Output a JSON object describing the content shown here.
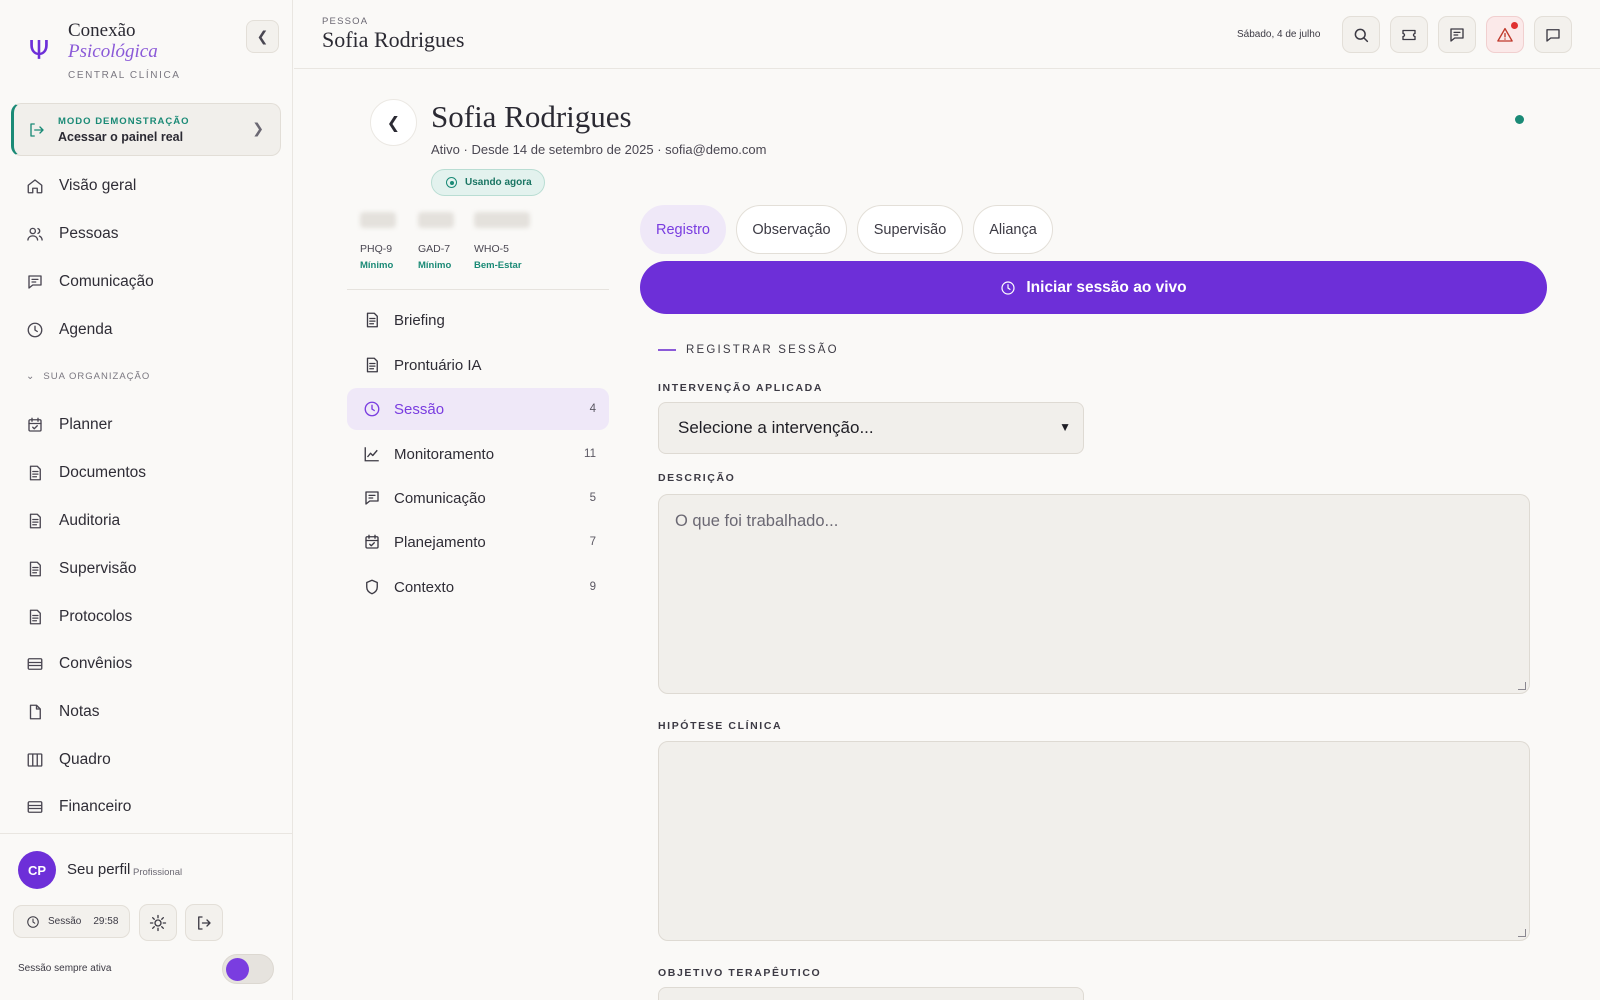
{
  "brand": {
    "line1": "Conexão",
    "line2": "Psicológica",
    "line3": "CENTRAL CLÍNICA"
  },
  "demo": {
    "kicker": "MODO DEMONSTRAÇÃO",
    "title": "Acessar o painel real"
  },
  "nav_main": [
    {
      "label": "Visão geral",
      "icon": "home-icon"
    },
    {
      "label": "Pessoas",
      "icon": "users-icon"
    },
    {
      "label": "Comunicação",
      "icon": "message-icon"
    },
    {
      "label": "Agenda",
      "icon": "clock-icon"
    }
  ],
  "org_section": "SUA ORGANIZAÇÃO",
  "nav_org": [
    {
      "label": "Planner",
      "icon": "calendar-check-icon"
    },
    {
      "label": "Documentos",
      "icon": "document-icon"
    },
    {
      "label": "Auditoria",
      "icon": "document-icon"
    },
    {
      "label": "Supervisão",
      "icon": "document-icon"
    },
    {
      "label": "Protocolos",
      "icon": "document-icon"
    },
    {
      "label": "Convênios",
      "icon": "card-icon"
    },
    {
      "label": "Notas",
      "icon": "file-icon"
    },
    {
      "label": "Quadro",
      "icon": "columns-icon"
    },
    {
      "label": "Financeiro",
      "icon": "card-icon"
    }
  ],
  "profile": {
    "initials": "CP",
    "name": "Seu perfil",
    "role": "Profissional"
  },
  "session_timer": {
    "label": "Sessão",
    "time": "29:58"
  },
  "always_active": {
    "label": "Sessão sempre ativa",
    "enabled": true
  },
  "header": {
    "kicker": "PESSOA",
    "title": "Sofia Rodrigues",
    "date": "Sábado, 4 de julho"
  },
  "person": {
    "name": "Sofia Rodrigues",
    "meta": "Ativo · Desde 14 de setembro de 2025 · sofia@demo.com",
    "badge": "Usando agora"
  },
  "scores": [
    {
      "name": "PHQ-9",
      "level": "Mínimo"
    },
    {
      "name": "GAD-7",
      "level": "Mínimo"
    },
    {
      "name": "WHO-5",
      "level": "Bem-Estar"
    }
  ],
  "menu": [
    {
      "label": "Briefing",
      "count": "",
      "icon": "document-icon"
    },
    {
      "label": "Prontuário IA",
      "count": "",
      "icon": "document-icon"
    },
    {
      "label": "Sessão",
      "count": "4",
      "icon": "clock-icon"
    },
    {
      "label": "Monitoramento",
      "count": "11",
      "icon": "chart-line-icon"
    },
    {
      "label": "Comunicação",
      "count": "5",
      "icon": "message-icon"
    },
    {
      "label": "Planejamento",
      "count": "7",
      "icon": "calendar-check-icon"
    },
    {
      "label": "Contexto",
      "count": "9",
      "icon": "shield-icon"
    }
  ],
  "tabs": [
    "Registro",
    "Observação",
    "Supervisão",
    "Aliança"
  ],
  "live_button": "Iniciar sessão ao vivo",
  "form": {
    "section": "REGISTRAR SESSÃO",
    "intervention_label": "INTERVENÇÃO APLICADA",
    "intervention_value": "Selecione a intervenção...",
    "description_label": "DESCRIÇÃO",
    "description_placeholder": "O que foi trabalhado...",
    "hypothesis_label": "HIPÓTESE CLÍNICA",
    "objective_label": "OBJETIVO TERAPÊUTICO"
  },
  "colors": {
    "accent": "#6d2fd8",
    "teal": "#1a8a76",
    "background": "#faf9f7"
  }
}
